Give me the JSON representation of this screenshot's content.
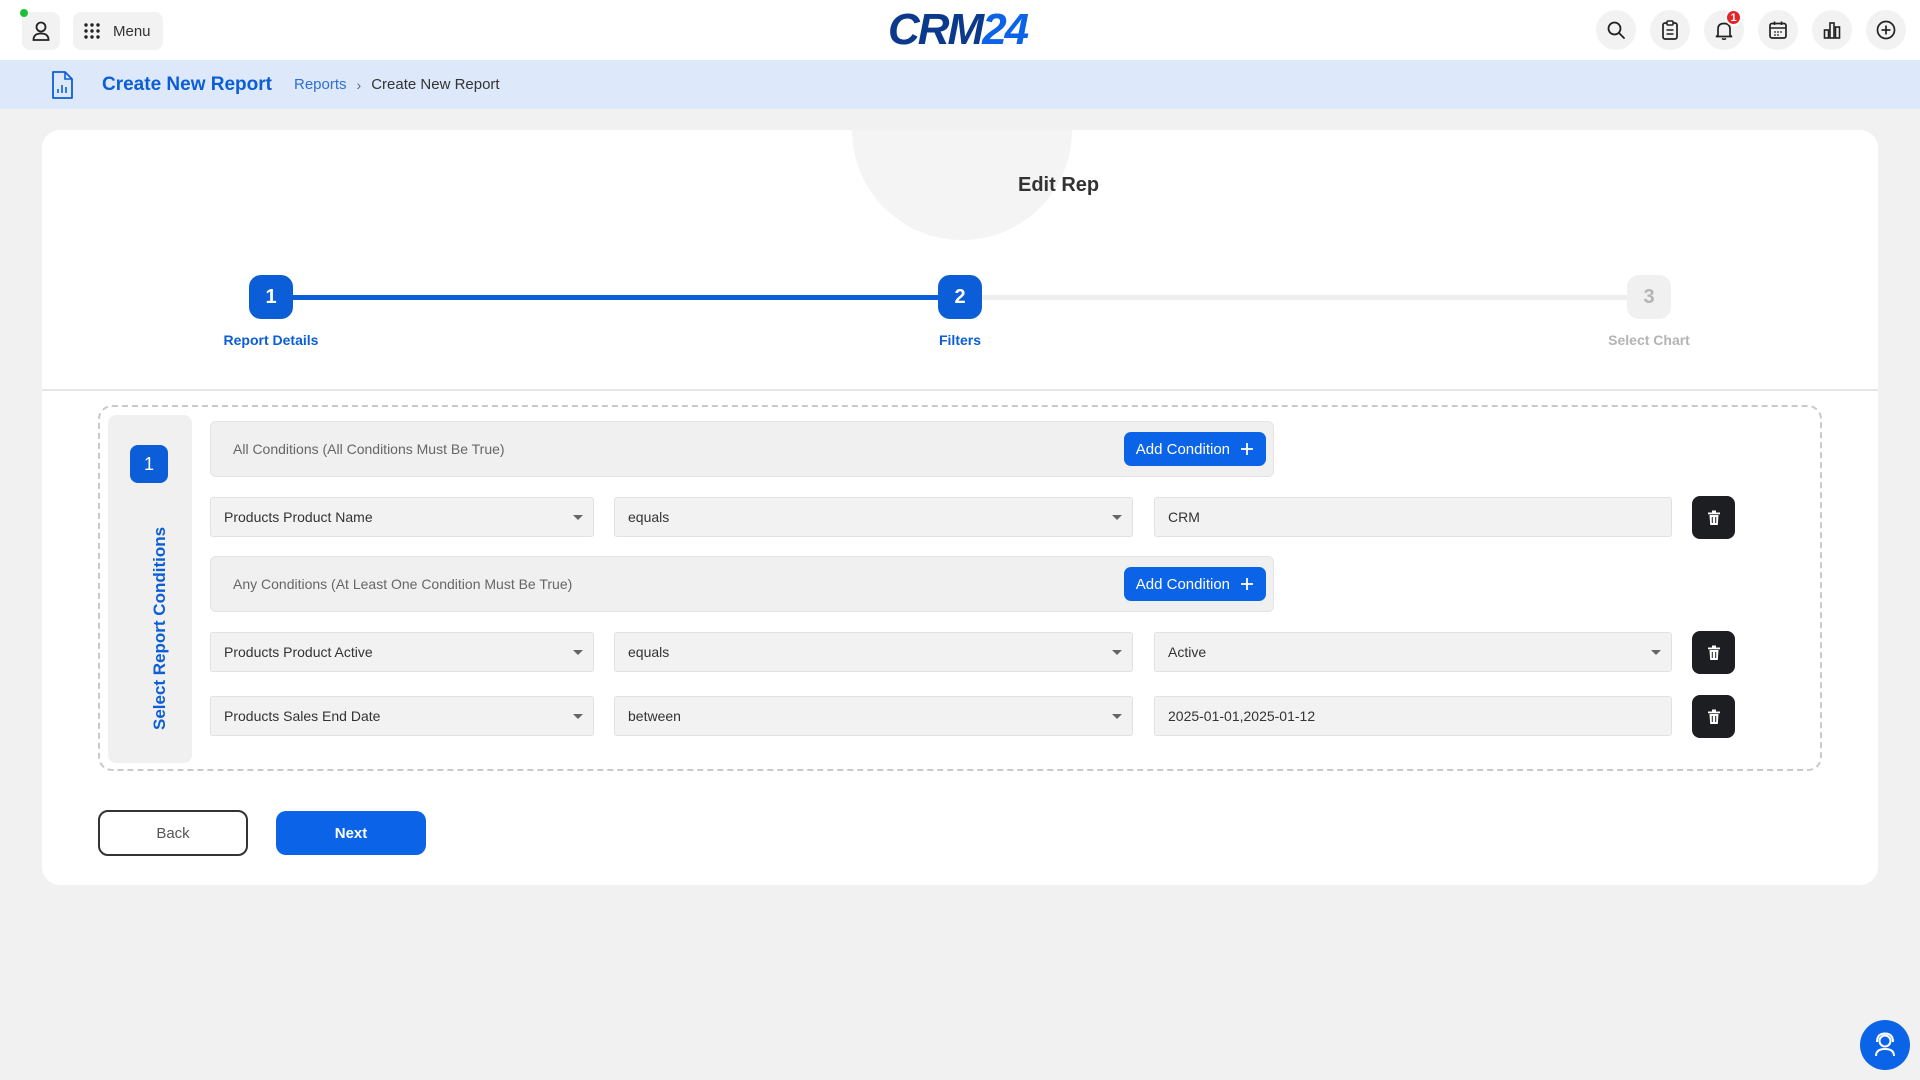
{
  "topbar": {
    "menu_label": "Menu",
    "logo_crm": "CRM",
    "logo_num": "24",
    "notification_count": "1",
    "icons": [
      "search-icon",
      "clipboard-icon",
      "bell-icon",
      "calendar-icon",
      "bar-chart-icon",
      "plus-circle-icon"
    ]
  },
  "breadcrumb": {
    "title": "Create New Report",
    "link": "Reports",
    "current": "Create New Report"
  },
  "card": {
    "title": "Edit Rep"
  },
  "stepper": {
    "steps": [
      {
        "number": "1",
        "label": "Report Details",
        "state": "active"
      },
      {
        "number": "2",
        "label": "Filters",
        "state": "active"
      },
      {
        "number": "3",
        "label": "Select Chart",
        "state": "inactive"
      }
    ]
  },
  "conditions": {
    "section_number": "1",
    "section_label": "Select Report Conditions",
    "add_label": "Add Condition",
    "all_group": {
      "title": "All Conditions (All Conditions Must Be True)",
      "rows": [
        {
          "field": "Products Product Name",
          "operator": "equals",
          "value": "CRM",
          "value_is_select": false
        }
      ]
    },
    "any_group": {
      "title": "Any Conditions (At Least One Condition Must Be True)",
      "rows": [
        {
          "field": "Products Product Active",
          "operator": "equals",
          "value": "Active",
          "value_is_select": true
        },
        {
          "field": "Products Sales End Date",
          "operator": "between",
          "value": "2025-01-01,2025-01-12",
          "value_is_select": false
        }
      ]
    }
  },
  "actions": {
    "back_label": "Back",
    "next_label": "Next"
  },
  "colors": {
    "primary": "#0b63e8",
    "accent_blue": "#0b5ed7",
    "breadcrumb_bg": "#dde9fb",
    "delete_bg": "#1c1e21",
    "badge": "#e52525",
    "online": "#1fbf3a"
  }
}
